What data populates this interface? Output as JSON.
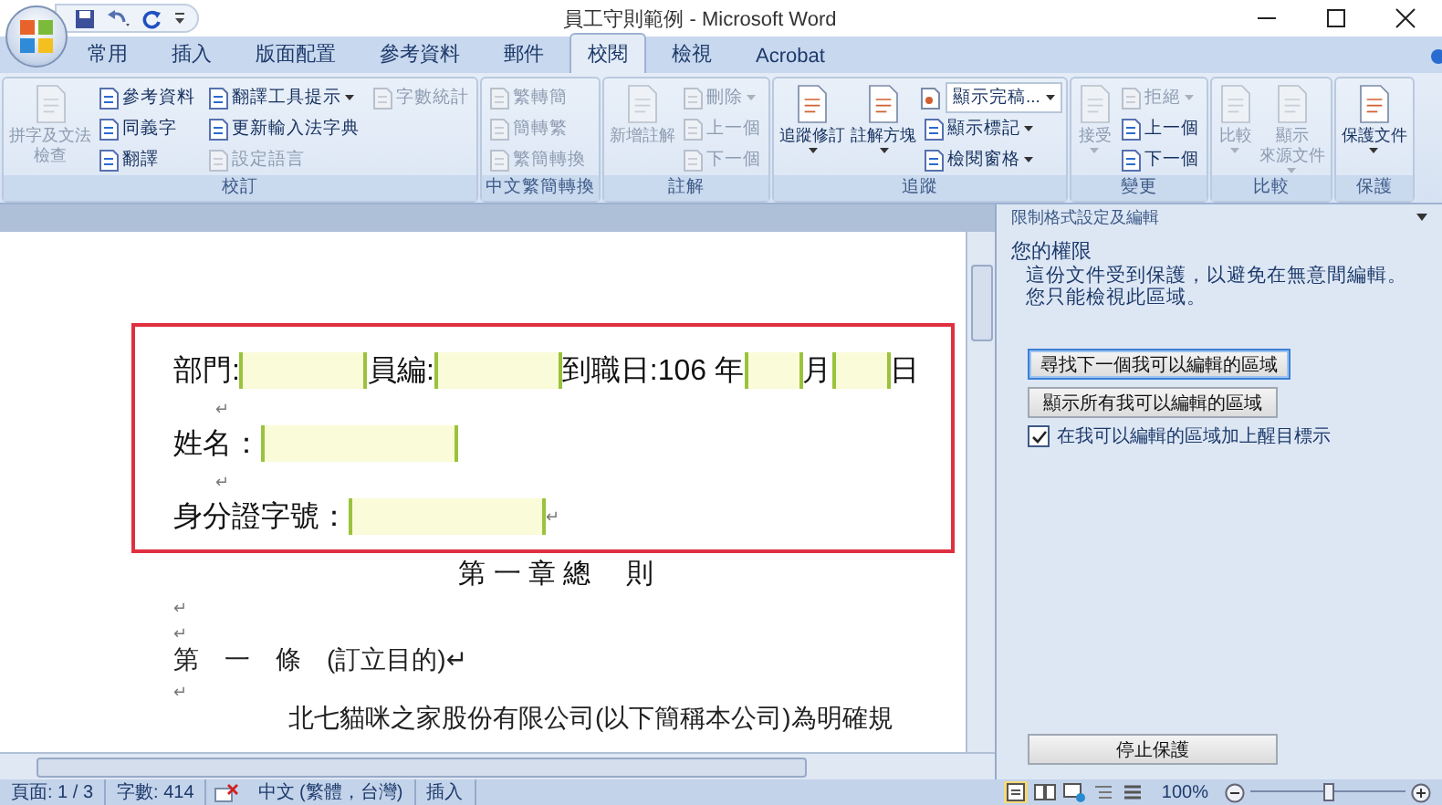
{
  "window": {
    "title": "員工守則範例 - Microsoft Word"
  },
  "tabs": [
    {
      "label": "常用",
      "selected": false
    },
    {
      "label": "插入",
      "selected": false
    },
    {
      "label": "版面配置",
      "selected": false
    },
    {
      "label": "參考資料",
      "selected": false
    },
    {
      "label": "郵件",
      "selected": false
    },
    {
      "label": "校閱",
      "selected": true
    },
    {
      "label": "檢視",
      "selected": false
    },
    {
      "label": "Acrobat",
      "selected": false
    }
  ],
  "ribbon": {
    "groups": [
      {
        "label": "校訂",
        "items": [
          {
            "kind": "large",
            "lines": [
              "拼字及文法",
              "檢查"
            ],
            "disabled": true,
            "dropdown": false
          },
          {
            "kind": "small",
            "label": "參考資料",
            "disabled": false,
            "dropdown": false
          },
          {
            "kind": "small",
            "label": "同義字",
            "disabled": false,
            "dropdown": false
          },
          {
            "kind": "small",
            "label": "翻譯",
            "disabled": false,
            "dropdown": false
          },
          {
            "kind": "small",
            "label": "翻譯工具提示",
            "disabled": false,
            "dropdown": true
          },
          {
            "kind": "small",
            "label": "更新輸入法字典",
            "disabled": false,
            "dropdown": false
          },
          {
            "kind": "small",
            "label": "設定語言",
            "disabled": true,
            "dropdown": false
          },
          {
            "kind": "small",
            "label": "字數統計",
            "disabled": true,
            "dropdown": false
          }
        ]
      },
      {
        "label": "中文繁簡轉換",
        "items": [
          {
            "kind": "small",
            "label": "繁轉簡",
            "disabled": true,
            "dropdown": false
          },
          {
            "kind": "small",
            "label": "簡轉繁",
            "disabled": true,
            "dropdown": false
          },
          {
            "kind": "small",
            "label": "繁簡轉換",
            "disabled": true,
            "dropdown": false
          }
        ]
      },
      {
        "label": "註解",
        "items": [
          {
            "kind": "large",
            "lines": [
              "新增註解"
            ],
            "disabled": true,
            "dropdown": false
          },
          {
            "kind": "small",
            "label": "刪除",
            "disabled": true,
            "dropdown": true
          },
          {
            "kind": "small",
            "label": "上一個",
            "disabled": true,
            "dropdown": false
          },
          {
            "kind": "small",
            "label": "下一個",
            "disabled": true,
            "dropdown": false
          }
        ]
      },
      {
        "label": "追蹤",
        "items": [
          {
            "kind": "large",
            "lines": [
              "追蹤修訂"
            ],
            "disabled": false,
            "dropdown": true
          },
          {
            "kind": "large",
            "lines": [
              "註解方塊"
            ],
            "disabled": false,
            "dropdown": true
          },
          {
            "kind": "combo",
            "label": "顯示完稿...",
            "disabled": false,
            "dropdown": true
          },
          {
            "kind": "small",
            "label": "顯示標記",
            "disabled": false,
            "dropdown": true
          },
          {
            "kind": "small",
            "label": "檢閱窗格",
            "disabled": false,
            "dropdown": true
          }
        ]
      },
      {
        "label": "變更",
        "items": [
          {
            "kind": "large",
            "lines": [
              "接受"
            ],
            "disabled": true,
            "dropdown": true
          },
          {
            "kind": "small",
            "label": "拒絕",
            "disabled": true,
            "dropdown": true
          },
          {
            "kind": "small",
            "label": "上一個",
            "disabled": false,
            "dropdown": false
          },
          {
            "kind": "small",
            "label": "下一個",
            "disabled": false,
            "dropdown": false
          }
        ]
      },
      {
        "label": "比較",
        "items": [
          {
            "kind": "large",
            "lines": [
              "比較"
            ],
            "disabled": true,
            "dropdown": true
          },
          {
            "kind": "large",
            "lines": [
              "顯示",
              "來源文件"
            ],
            "disabled": true,
            "dropdown": true
          }
        ]
      },
      {
        "label": "保護",
        "items": [
          {
            "kind": "large",
            "lines": [
              "保護文件"
            ],
            "disabled": false,
            "dropdown": true
          }
        ]
      }
    ]
  },
  "document": {
    "highlighted_block": [
      {
        "kind": "form",
        "segments": [
          {
            "kind": "text",
            "text": "部門:"
          },
          {
            "kind": "field"
          },
          {
            "kind": "text",
            "text": "員編:"
          },
          {
            "kind": "field"
          },
          {
            "kind": "text",
            "text": "到職日:106 年"
          },
          {
            "kind": "narrowfield"
          },
          {
            "kind": "text",
            "text": "月"
          },
          {
            "kind": "narrowfield"
          },
          {
            "kind": "text",
            "text": "日"
          }
        ]
      },
      {
        "kind": "blank",
        "text": "↵"
      },
      {
        "kind": "form",
        "segments": [
          {
            "kind": "text",
            "text": "姓名："
          },
          {
            "kind": "widefield"
          }
        ]
      },
      {
        "kind": "blank",
        "text": "↵"
      },
      {
        "kind": "form",
        "segments": [
          {
            "kind": "text",
            "text": "身分證字號："
          },
          {
            "kind": "widefield"
          },
          {
            "kind": "mark",
            "text": "↵"
          }
        ]
      }
    ],
    "paragraphs": [
      {
        "kind": "heading",
        "text": "第 一 章 總　 則"
      },
      {
        "kind": "blank",
        "text": "↵"
      },
      {
        "kind": "blank",
        "text": "↵"
      },
      {
        "kind": "article",
        "text": "第　一　條　(訂立目的)↵"
      },
      {
        "kind": "blank",
        "text": "↵"
      },
      {
        "kind": "body",
        "text": "北七貓咪之家股份有限公司(以下簡稱本公司)為明確規"
      }
    ]
  },
  "task_pane": {
    "title": "限制格式設定及編輯",
    "heading": "您的權限",
    "messages": [
      "這份文件受到保護，以避免在無意間編輯。",
      "您只能檢視此區域。"
    ],
    "buttons": [
      {
        "label": "尋找下一個我可以編輯的區域",
        "selected": true
      },
      {
        "label": "顯示所有我可以編輯的區域",
        "selected": false
      }
    ],
    "checkbox": {
      "label": "在我可以編輯的區域加上醒目標示",
      "checked": true
    },
    "stop_button": "停止保護"
  },
  "status_bar": {
    "page": "頁面: 1 / 3",
    "words": "字數: 414",
    "language": "中文 (繁體，台灣)",
    "mode": "插入",
    "zoom": "100%",
    "zoom_slider": {
      "level": 0.5
    }
  }
}
